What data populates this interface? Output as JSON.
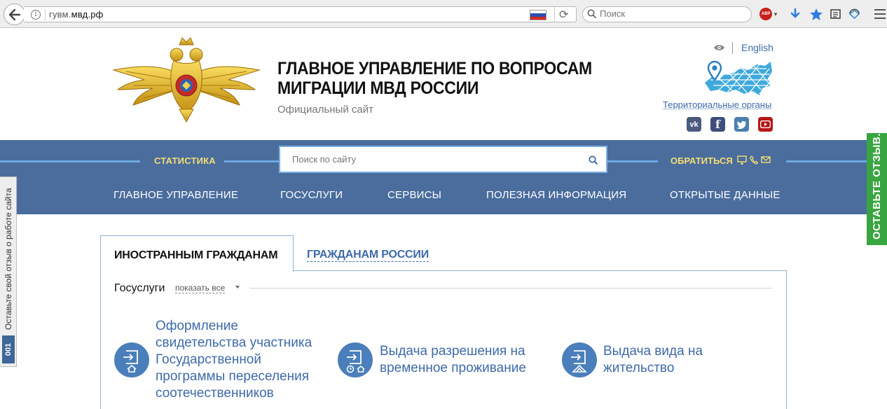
{
  "browser": {
    "url_prefix": "гувм.",
    "url_domain": "мвд.рф",
    "search_placeholder": "Поиск",
    "abp_label": "ABP"
  },
  "header": {
    "title_line1": "ГЛАВНОЕ УПРАВЛЕНИЕ ПО ВОПРОСАМ",
    "title_line2": "МИГРАЦИИ МВД РОССИИ",
    "subtitle": "Официальный сайт",
    "language_link": "English",
    "territorial_link": "Территориальные органы",
    "social": {
      "vk": "vk",
      "fb": "f"
    }
  },
  "nav": {
    "statistics": "СТАТИСТИКА",
    "search_placeholder": "Поиск по сайту",
    "contact": "ОБРАТИТЬСЯ",
    "menu": [
      "ГЛАВНОЕ УПРАВЛЕНИЕ",
      "ГОСУСЛУГИ",
      "СЕРВИСЫ",
      "ПОЛЕЗНАЯ ИНФОРМАЦИЯ",
      "ОТКРЫТЫЕ ДАННЫЕ"
    ]
  },
  "side": {
    "feedback_left": "Оставьте свой отзыв о работе сайта",
    "feedback_badge": "001",
    "feedback_right": "ОСТАВЬТЕ ОТЗЫВ."
  },
  "content": {
    "tab_active": "ИНОСТРАННЫМ ГРАЖДАНАМ",
    "tab_inactive": "ГРАЖДАНАМ РОССИИ",
    "section_label": "Госуслуги",
    "show_all": "показать все",
    "services": [
      {
        "lines": [
          "Оформление",
          "свидетельства участника",
          "Государственной",
          "программы переселения",
          "соотечественников"
        ]
      },
      {
        "lines": [
          "Выдача разрешения на",
          "временное проживание"
        ]
      },
      {
        "lines": [
          "Выдача вида на",
          "жительство"
        ]
      }
    ]
  },
  "colors": {
    "nav_blue": "#4a6d9d",
    "accent_yellow": "#f5dc72",
    "link_blue": "#3e6aa8",
    "feedback_green": "#39a540"
  }
}
